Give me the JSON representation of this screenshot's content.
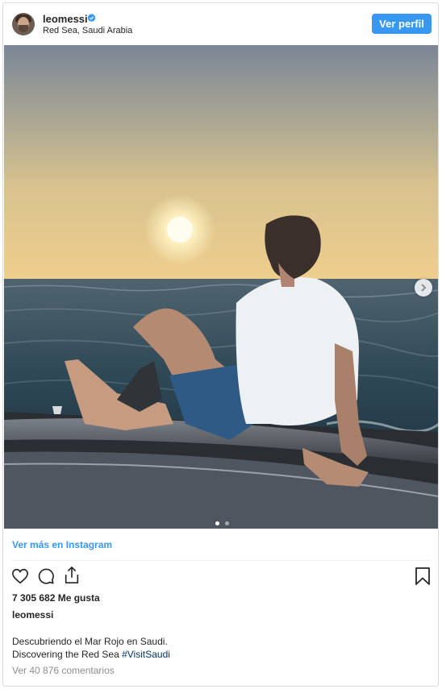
{
  "header": {
    "username": "leomessi",
    "location": "Red Sea, Saudi Arabia",
    "view_profile_label": "Ver perfil",
    "verified_icon": "verified-badge-icon",
    "accent_color": "#3897f0"
  },
  "photo": {
    "next_icon": "chevron-right-icon",
    "carousel": {
      "current": 1,
      "total": 2
    }
  },
  "view_more_label": "Ver más en Instagram",
  "actions": {
    "like_icon": "heart-icon",
    "comment_icon": "comment-icon",
    "share_icon": "share-icon",
    "save_icon": "bookmark-icon"
  },
  "likes_text": "7 305 682 Me gusta",
  "caption": {
    "username": "leomessi",
    "line1": "Descubriendo el Mar Rojo en Saudi.",
    "line2": "Discovering the Red Sea",
    "hashtag": "#VisitSaudi"
  },
  "comments_text": "Ver 40 876 comentarios"
}
